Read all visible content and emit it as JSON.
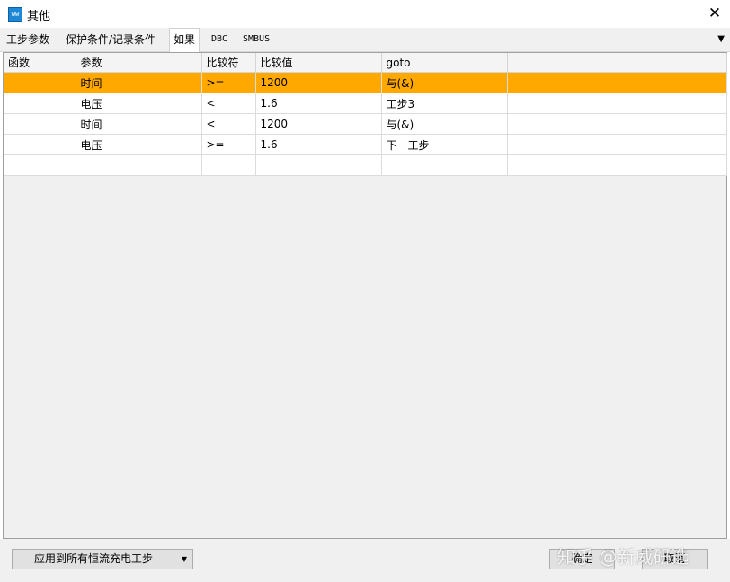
{
  "window": {
    "title": "其他",
    "icon": "app-icon",
    "icon_text": "WW"
  },
  "tabs": [
    {
      "label": "工步参数"
    },
    {
      "label": "保护条件/记录条件"
    },
    {
      "label": "如果"
    },
    {
      "label": "DBC"
    },
    {
      "label": "SMBUS"
    }
  ],
  "tabs_active": "如果",
  "table": {
    "columns": [
      "函数",
      "参数",
      "比较符",
      "比较值",
      "goto"
    ],
    "rows": [
      {
        "func": "",
        "param": "时间",
        "op": ">=",
        "value": "1200",
        "goto": "与(&)"
      },
      {
        "func": "",
        "param": "电压",
        "op": "<",
        "value": "1.6",
        "goto": "工步3"
      },
      {
        "func": "",
        "param": "时间",
        "op": "<",
        "value": "1200",
        "goto": "与(&)"
      },
      {
        "func": "",
        "param": "电压",
        "op": ">=",
        "value": "1.6",
        "goto": "下一工步"
      },
      {
        "func": "",
        "param": "",
        "op": "",
        "value": "",
        "goto": ""
      }
    ],
    "selected_row": 0,
    "selected_color": "#ffa800"
  },
  "bottom": {
    "apply_label": "应用到所有恒流充电工步",
    "ok_label": "确定",
    "cancel_label": "取消"
  },
  "watermark": "知乎 @新威研选"
}
